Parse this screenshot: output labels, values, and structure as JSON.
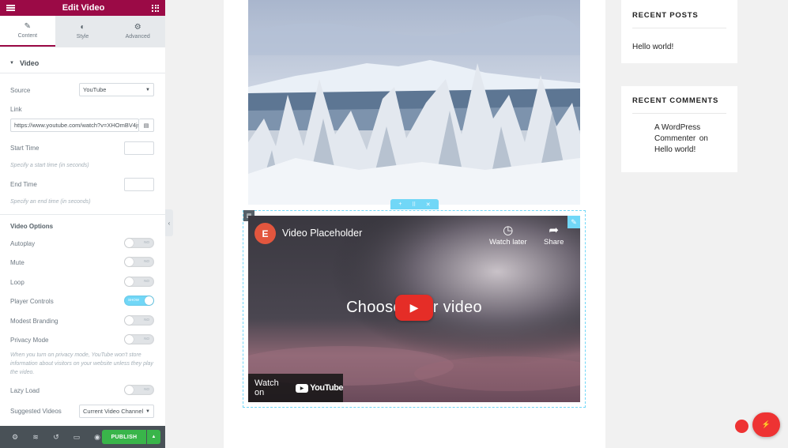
{
  "panel": {
    "title": "Edit Video",
    "tabs": [
      {
        "label": "Content",
        "icon": "pencil-icon"
      },
      {
        "label": "Style",
        "icon": "half-circle-icon"
      },
      {
        "label": "Advanced",
        "icon": "gear-icon"
      }
    ],
    "section": "Video",
    "source": {
      "label": "Source",
      "value": "YouTube"
    },
    "link": {
      "label": "Link",
      "value": "https://www.youtube.com/watch?v=XHOmBV4js_E"
    },
    "start_time": {
      "label": "Start Time",
      "desc": "Specify a start time (in seconds)"
    },
    "end_time": {
      "label": "End Time",
      "desc": "Specify an end time (in seconds)"
    },
    "video_options_heading": "Video Options",
    "options": [
      {
        "label": "Autoplay",
        "state": "NO"
      },
      {
        "label": "Mute",
        "state": "NO"
      },
      {
        "label": "Loop",
        "state": "NO"
      },
      {
        "label": "Player Controls",
        "state": "SHOW"
      },
      {
        "label": "Modest Branding",
        "state": "NO"
      },
      {
        "label": "Privacy Mode",
        "state": "NO"
      }
    ],
    "privacy_desc": "When you turn on privacy mode, YouTube won't store information about visitors on your website unless they play the video.",
    "lazy_load": {
      "label": "Lazy Load",
      "state": "NO"
    },
    "suggested": {
      "label": "Suggested Videos",
      "value": "Current Video Channel"
    },
    "footer": {
      "publish": "PUBLISH"
    }
  },
  "video": {
    "title": "Video Placeholder",
    "watch_later": "Watch later",
    "share": "Share",
    "center_text": "Choose your video",
    "watch_on": "Watch on",
    "youtube": "YouTube"
  },
  "sidebar": {
    "recent_posts": {
      "heading": "RECENT POSTS",
      "items": [
        "Hello world!"
      ]
    },
    "recent_comments": {
      "heading": "RECENT COMMENTS",
      "author": "A WordPress Commenter",
      "on": "on",
      "post": "Hello world!"
    }
  },
  "colors": {
    "brand": "#9b0a46",
    "accent": "#71d7f7",
    "publish": "#39b54a"
  }
}
